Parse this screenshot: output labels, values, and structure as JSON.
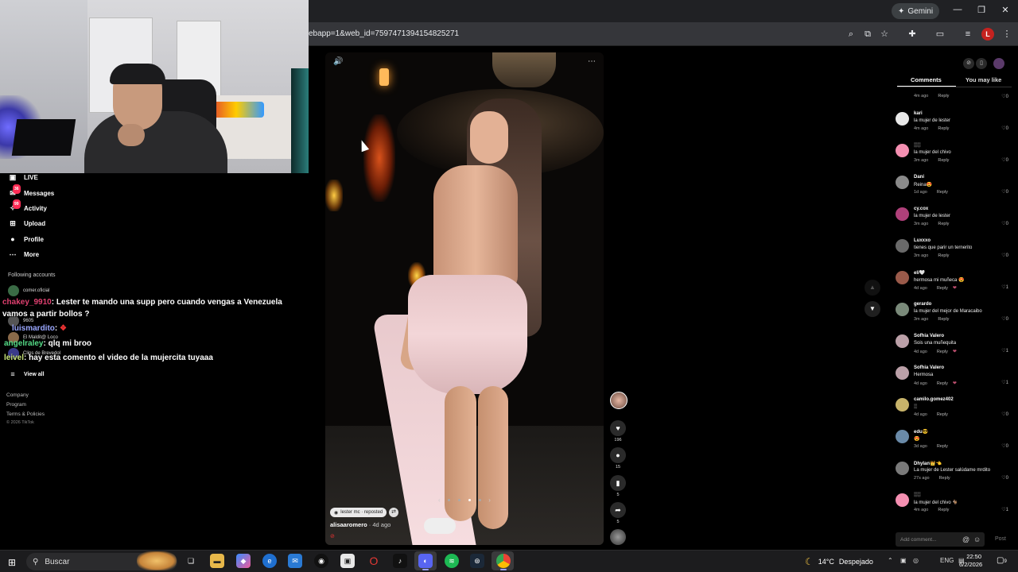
{
  "browser": {
    "url": "ebapp=1&web_id=7597471394154825271",
    "gemini_label": "Gemini",
    "profile_initial": "L"
  },
  "nav": {
    "items": [
      {
        "label": "LIVE",
        "icon": "live-icon"
      },
      {
        "label": "Messages",
        "icon": "messages-icon"
      },
      {
        "label": "Activity",
        "icon": "activity-icon"
      },
      {
        "label": "Upload",
        "icon": "upload-icon"
      },
      {
        "label": "Profile",
        "icon": "profile-icon"
      },
      {
        "label": "More",
        "icon": "more-icon"
      }
    ],
    "following_title": "Following accounts",
    "accounts": [
      {
        "name": "comer.oficial"
      },
      {
        "name": "9605"
      },
      {
        "name": "El Maldit@ Loco"
      },
      {
        "name": "Clips de Brevedol"
      }
    ],
    "view_all": "View all",
    "footer": [
      "Company",
      "Program",
      "Terms & Policies"
    ],
    "copyright": "© 2026 TikTok"
  },
  "chat": [
    {
      "user": "chakey_9910",
      "text": ": Lester te mando una supp pero cuando vengas a Venezuela"
    },
    {
      "user": "",
      "text": "vamos a partir bollos ?"
    },
    {
      "user": "luismardito",
      "text": ":"
    },
    {
      "user": "angelraley",
      "text": ": qlq mi broo"
    },
    {
      "user": "leivel",
      "text": ": hay esta comento el video de la mujercita tuyaaa"
    }
  ],
  "video": {
    "repost_label": "lester mc · reposted",
    "author": "alisaaromero",
    "age": " · 4d ago",
    "likes": "196",
    "comments": "15",
    "saves": "5",
    "shares": "5"
  },
  "panel": {
    "tabs": [
      "Comments",
      "You may like"
    ],
    "comments": [
      {
        "user": "",
        "text": "",
        "time": "4m ago",
        "likes": "0",
        "av": "#444",
        "heart": false
      },
      {
        "user": "kari",
        "text": "la mujer de lester",
        "time": "4m ago",
        "likes": "0",
        "av": "#e8e8e8",
        "heart": false
      },
      {
        "user": "░░",
        "text": "la mujer del chivo",
        "time": "3m ago",
        "likes": "0",
        "av": "#f48fb1",
        "heart": false
      },
      {
        "user": "Dani",
        "text": "Reina😍",
        "time": "1d ago",
        "likes": "0",
        "av": "#8a8a8a",
        "heart": false
      },
      {
        "user": "cy.cox",
        "text": "la mujer de lester",
        "time": "3m ago",
        "likes": "0",
        "av": "#b0407a",
        "heart": false
      },
      {
        "user": "Luxxxo",
        "text": "tienes que parir un ternerito",
        "time": "3m ago",
        "likes": "0",
        "av": "#6a6a6a",
        "heart": false
      },
      {
        "user": "eli🤍",
        "text": "hermosa mi muñeca 😍",
        "time": "4d ago",
        "likes": "1",
        "av": "#9a5a4a",
        "heart": true
      },
      {
        "user": "gerardo",
        "text": "la mujer del mejor de Maracaibo",
        "time": "3m ago",
        "likes": "0",
        "av": "#7a8a7a",
        "heart": false
      },
      {
        "user": "Sofhia Valero",
        "text": "Sois una muñequita",
        "time": "4d ago",
        "likes": "1",
        "av": "#bba0a8",
        "heart": true
      },
      {
        "user": "Sofhia Valero",
        "text": "Hermosa",
        "time": "4d ago",
        "likes": "1",
        "av": "#bba0a8",
        "heart": true
      },
      {
        "user": "camilo.gomez402",
        "text": "░",
        "time": "4d ago",
        "likes": "0",
        "av": "#c7b36a",
        "heart": false
      },
      {
        "user": "edu😎",
        "text": "😍",
        "time": "3d ago",
        "likes": "0",
        "av": "#6a8aa8",
        "heart": false
      },
      {
        "user": "Dhylan👑👈",
        "text": "La mujer de Lester salúdame mrdito",
        "time": "27s ago",
        "likes": "0",
        "av": "#7a7a7a",
        "heart": false
      },
      {
        "user": "░░",
        "text": "la mujer del chivo 🐐",
        "time": "4m ago",
        "likes": "1",
        "av": "#f48fb1",
        "heart": false
      }
    ],
    "reply_label": "Reply",
    "add_comment_placeholder": "Add comment...",
    "post_label": "Post"
  },
  "taskbar": {
    "search_label": "Buscar",
    "temp": "14°C",
    "weather": "Despejado",
    "lang": "ENG",
    "time": "22:50",
    "date": "6/2/2026",
    "notif_count": "9"
  }
}
